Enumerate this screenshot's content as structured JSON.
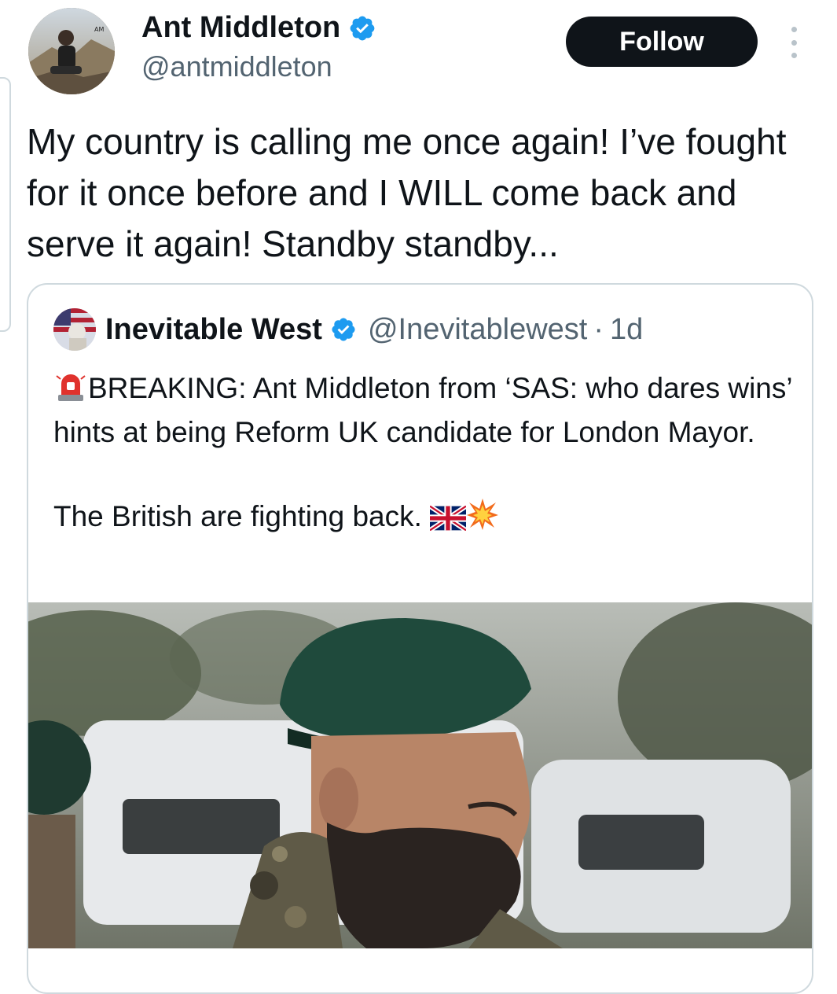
{
  "author": {
    "display_name": "Ant Middleton",
    "handle": "@antmiddleton",
    "verified": true,
    "avatar_icon": "avatar-photo-icon"
  },
  "actions": {
    "follow_label": "Follow",
    "more_icon": "more-options-icon"
  },
  "tweet": {
    "text": "My country is calling me once again! I’ve fought for it once before and I WILL come back and serve it again! Standby standby..."
  },
  "quoted": {
    "display_name": "Inevitable West",
    "handle": "@Inevitablewest",
    "separator": "·",
    "time": "1d",
    "verified": true,
    "body_line1": "BREAKING: Ant Middleton from ‘SAS: who dares wins’ hints at being Reform UK candidate for London Mayor.",
    "body_line2": "The British are fighting back.",
    "emojis": [
      "siren-emoji",
      "uk-flag-emoji",
      "collision-emoji"
    ],
    "image_icon": "soldier-photo-image"
  },
  "colors": {
    "text_primary": "#0f1419",
    "text_secondary": "#536471",
    "verified_blue": "#1d9bf0",
    "border": "#cfd9de",
    "follow_bg": "#0f1419"
  }
}
